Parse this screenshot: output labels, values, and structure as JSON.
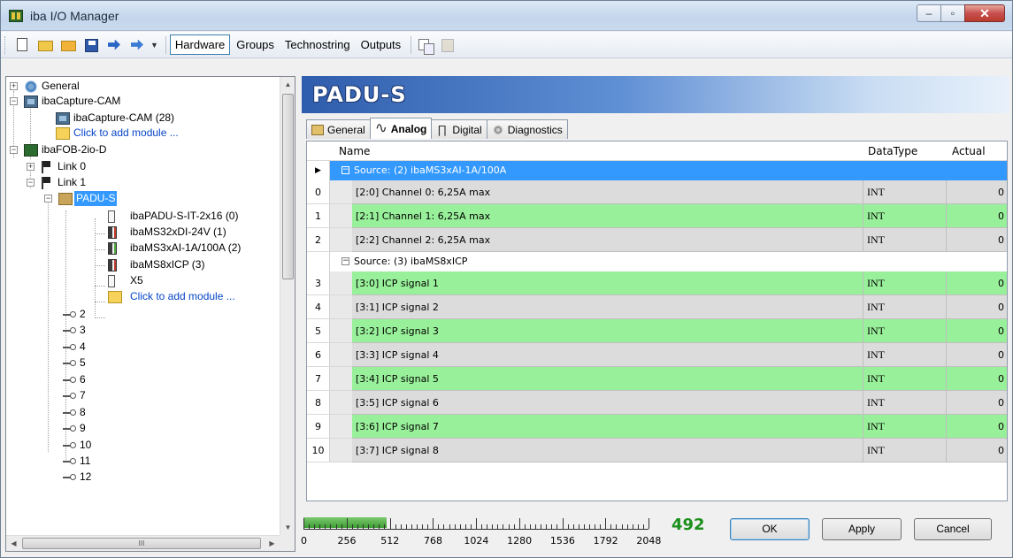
{
  "window": {
    "title": "iba I/O Manager"
  },
  "toolbar": {
    "tabs": [
      "Hardware",
      "Groups",
      "Technostring",
      "Outputs"
    ],
    "active_tab": "Hardware"
  },
  "tree": {
    "items": [
      {
        "label": "General"
      },
      {
        "label": "ibaCapture-CAM"
      },
      {
        "label": "ibaCapture-CAM (28)"
      },
      {
        "label": "Click to add module ..."
      },
      {
        "label": "ibaFOB-2io-D"
      },
      {
        "label": "Link 0"
      },
      {
        "label": "Link 1"
      },
      {
        "label": "PADU-S"
      },
      {
        "label": "ibaPADU-S-IT-2x16 (0)"
      },
      {
        "label": "ibaMS32xDI-24V (1)"
      },
      {
        "label": "ibaMS3xAI-1A/100A (2)"
      },
      {
        "label": "ibaMS8xICP (3)"
      },
      {
        "label": "X5"
      },
      {
        "label": "Click to add module ..."
      },
      {
        "label": "2"
      },
      {
        "label": "3"
      },
      {
        "label": "4"
      },
      {
        "label": "5"
      },
      {
        "label": "6"
      },
      {
        "label": "7"
      },
      {
        "label": "8"
      },
      {
        "label": "9"
      },
      {
        "label": "10"
      },
      {
        "label": "11"
      },
      {
        "label": "12"
      }
    ],
    "hscroll_grip": "III"
  },
  "panel": {
    "title": "PADU-S",
    "tabs": [
      "General",
      "Analog",
      "Digital",
      "Diagnostics"
    ],
    "active_tab": "Analog"
  },
  "grid": {
    "columns": {
      "name": "Name",
      "datatype": "DataType",
      "actual": "Actual"
    },
    "sources": [
      {
        "label": "Source: (2) ibaMS3xAI-1A/100A",
        "rows": [
          {
            "index": "0",
            "name": "[2:0] Channel 0: 6,25A max",
            "datatype": "INT",
            "actual": "0",
            "color": "gray"
          },
          {
            "index": "1",
            "name": "[2:1] Channel 1: 6,25A max",
            "datatype": "INT",
            "actual": "0",
            "color": "green"
          },
          {
            "index": "2",
            "name": "[2:2] Channel 2: 6,25A max",
            "datatype": "INT",
            "actual": "0",
            "color": "gray"
          }
        ]
      },
      {
        "label": "Source: (3) ibaMS8xICP",
        "rows": [
          {
            "index": "3",
            "name": "[3:0] ICP signal 1",
            "datatype": "INT",
            "actual": "0",
            "color": "green"
          },
          {
            "index": "4",
            "name": "[3:1] ICP signal 2",
            "datatype": "INT",
            "actual": "0",
            "color": "gray"
          },
          {
            "index": "5",
            "name": "[3:2] ICP signal 3",
            "datatype": "INT",
            "actual": "0",
            "color": "green"
          },
          {
            "index": "6",
            "name": "[3:3] ICP signal 4",
            "datatype": "INT",
            "actual": "0",
            "color": "gray"
          },
          {
            "index": "7",
            "name": "[3:4] ICP signal 5",
            "datatype": "INT",
            "actual": "0",
            "color": "green"
          },
          {
            "index": "8",
            "name": "[3:5] ICP signal 6",
            "datatype": "INT",
            "actual": "0",
            "color": "gray"
          },
          {
            "index": "9",
            "name": "[3:6] ICP signal 7",
            "datatype": "INT",
            "actual": "0",
            "color": "green"
          },
          {
            "index": "10",
            "name": "[3:7] ICP signal 8",
            "datatype": "INT",
            "actual": "0",
            "color": "gray"
          }
        ]
      }
    ]
  },
  "status": {
    "scale_labels": [
      "0",
      "256",
      "512",
      "768",
      "1024",
      "1280",
      "1536",
      "1792",
      "2048"
    ],
    "scale_max": 2048,
    "used_signals": 492,
    "count_label": "492"
  },
  "buttons": {
    "ok": "OK",
    "apply": "Apply",
    "cancel": "Cancel"
  },
  "colors": {
    "row_green": "#99f09a",
    "row_gray": "#dcdcdc",
    "selection": "#3399ff",
    "count_green": "#1b8f1b"
  }
}
